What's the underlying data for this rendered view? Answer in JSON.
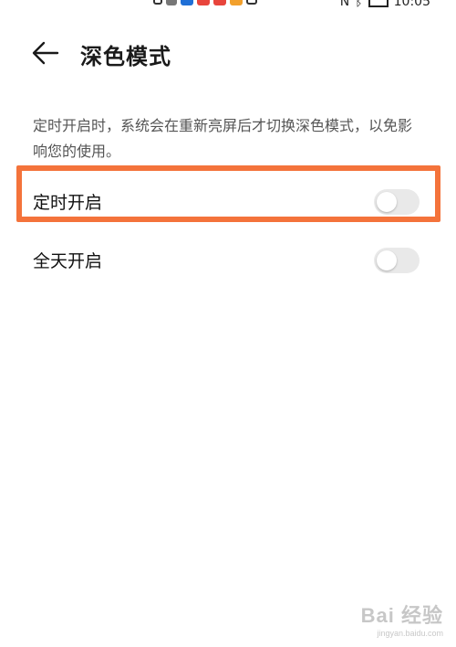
{
  "status_bar": {
    "time": "10:05",
    "app_colors": [
      "#1f6fd6",
      "#e8453c",
      "#e8453c",
      "#f2a02c"
    ]
  },
  "header": {
    "back_icon": "arrow-left-icon",
    "title": "深色模式"
  },
  "description": "定时开启时，系统会在重新亮屏后才切换深色模式，以免影响您的使用。",
  "settings": {
    "scheduled": {
      "label": "定时开启",
      "enabled": false
    },
    "all_day": {
      "label": "全天开启",
      "enabled": false
    }
  },
  "highlight_color": "#f4733b",
  "watermark": {
    "main": "Bai 经验",
    "sub": "jingyan.baidu.com"
  }
}
